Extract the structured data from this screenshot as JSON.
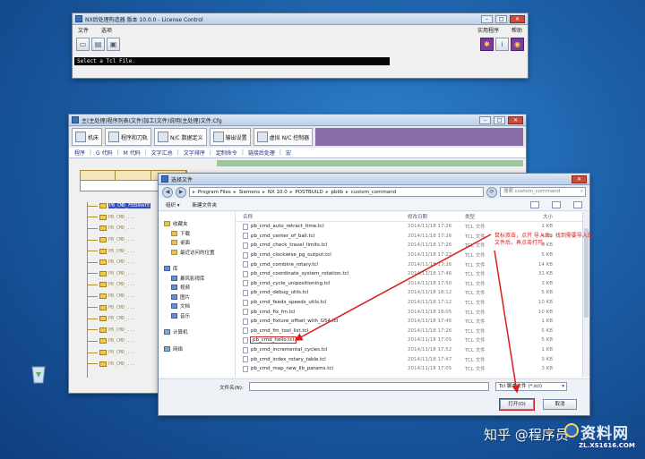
{
  "window1": {
    "title": "NX后处理构造器 版本 10.0.0 - License Control",
    "menu_file": "文件",
    "menu_options": "选项",
    "menu_tools": "实用程序",
    "menu_help": "帮助",
    "status": "Select a Tcl File."
  },
  "window2": {
    "title": "主(主处理)程序列表(文件)加工(文件)说明(主处理)文件.Cfg",
    "tabs": [
      "机床",
      "程序和刀轨",
      "N/C 数据定义",
      "输出设置",
      "虚拟 N/C 控制器"
    ],
    "menu": [
      "程序",
      "G 代码",
      "M 代码",
      "文字汇总",
      "文字排序",
      "定制命令",
      "链接后处理",
      "宏"
    ],
    "tree_selected": "PB_CMD_FEEDRATE",
    "tree_items": [
      "PB_CMD_...",
      "PB_CMD_...",
      "PB_CMD_...",
      "PB_CMD_...",
      "PB_CMD_...",
      "PB_CMD_...",
      "PB_CMD_...",
      "PB_CMD_...",
      "PB_CMD_...",
      "PB_CMD_...",
      "PB_CMD_...",
      "PB_CMD_...",
      "PB_CMD_...",
      "PB_CMD_..."
    ]
  },
  "dialog": {
    "title": "选择文件",
    "path": [
      "Program Files",
      "Siemens",
      "NX 10.0",
      "POSTBUILD",
      "pblib",
      "custom_command"
    ],
    "search_placeholder": "搜索 custom_command",
    "organize": "组织 ▾",
    "new_folder": "新建文件夹",
    "nav_items": [
      {
        "label": "收藏夹",
        "type": "fav",
        "sub": false
      },
      {
        "label": "下载",
        "type": "fav",
        "sub": true
      },
      {
        "label": "桌面",
        "type": "fav",
        "sub": true
      },
      {
        "label": "最近访问的位置",
        "type": "fav",
        "sub": true
      },
      {
        "label": "",
        "type": "gap",
        "sub": false
      },
      {
        "label": "库",
        "type": "lib",
        "sub": false
      },
      {
        "label": "暴风影视库",
        "type": "lib",
        "sub": true
      },
      {
        "label": "视频",
        "type": "lib",
        "sub": true
      },
      {
        "label": "图片",
        "type": "lib",
        "sub": true
      },
      {
        "label": "文档",
        "type": "lib",
        "sub": true
      },
      {
        "label": "音乐",
        "type": "lib",
        "sub": true
      },
      {
        "label": "",
        "type": "gap",
        "sub": false
      },
      {
        "label": "计算机",
        "type": "pc",
        "sub": false
      },
      {
        "label": "",
        "type": "gap",
        "sub": false
      },
      {
        "label": "网络",
        "type": "pc",
        "sub": false
      }
    ],
    "columns": [
      "名称",
      "修改日期",
      "类型",
      "大小"
    ],
    "files": [
      {
        "name": "pb_cmd_auto_retract_time.tcl",
        "date": "2014/11/18 17:26",
        "type": "TCL 文件",
        "size": "1 KB"
      },
      {
        "name": "pb_cmd_center_of_ball.tcl",
        "date": "2014/11/18 17:26",
        "type": "TCL 文件",
        "size": "4 KB"
      },
      {
        "name": "pb_cmd_check_travel_limits.tcl",
        "date": "2014/11/18 17:26",
        "type": "TCL 文件",
        "size": "6 KB"
      },
      {
        "name": "pb_cmd_clockwise_pg_output.tcl",
        "date": "2014/11/18 17:22",
        "type": "TCL 文件",
        "size": "5 KB"
      },
      {
        "name": "pb_cmd_combine_rotary.tcl",
        "date": "2014/11/18 17:26",
        "type": "TCL 文件",
        "size": "14 KB"
      },
      {
        "name": "pb_cmd_coordinate_system_rotation.tcl",
        "date": "2014/11/18 17:46",
        "type": "TCL 文件",
        "size": "31 KB"
      },
      {
        "name": "pb_cmd_cycle_unipositioning.tcl",
        "date": "2014/11/18 17:50",
        "type": "TCL 文件",
        "size": "3 KB"
      },
      {
        "name": "pb_cmd_debug_utils.tcl",
        "date": "2014/11/18 18:12",
        "type": "TCL 文件",
        "size": "5 KB"
      },
      {
        "name": "pb_cmd_feeds_speeds_utils.tcl",
        "date": "2014/11/18 17:12",
        "type": "TCL 文件",
        "size": "10 KB"
      },
      {
        "name": "pb_cmd_fix_fm.tcl",
        "date": "2014/11/18 18:05",
        "type": "TCL 文件",
        "size": "10 KB"
      },
      {
        "name": "pb_cmd_fixture_offset_with_G54.tcl",
        "date": "2014/11/18 17:46",
        "type": "TCL 文件",
        "size": "1 KB"
      },
      {
        "name": "pb_cmd_fm_tool_list.tcl",
        "date": "2014/11/18 17:26",
        "type": "TCL 文件",
        "size": "5 KB"
      },
      {
        "name": "pb_cmd_hello.tcl",
        "date": "2014/11/18 17:05",
        "type": "TCL 文件",
        "size": "5 KB",
        "highlight": true
      },
      {
        "name": "pb_cmd_incremental_cycles.tcl",
        "date": "2014/11/18 17:52",
        "type": "TCL 文件",
        "size": "1 KB"
      },
      {
        "name": "pb_cmd_index_rotary_table.tcl",
        "date": "2014/11/18 17:47",
        "type": "TCL 文件",
        "size": "3 KB"
      },
      {
        "name": "pb_cmd_map_new_lib_params.tcl",
        "date": "2014/11/18 17:05",
        "type": "TCL 文件",
        "size": "3 KB"
      }
    ],
    "filename_label": "文件名(N):",
    "filetype": "Tcl 脚本文件 (*.tcl)",
    "open": "打开(O)",
    "cancel": "取消"
  },
  "annotation": "鼠标双击，点开 导入后，找到需要导入的文件后，再点击打开。",
  "watermark": {
    "zhihu": "知乎 @程序员",
    "site_title": "资料网",
    "site_url": "ZL.XS1616.COM"
  }
}
